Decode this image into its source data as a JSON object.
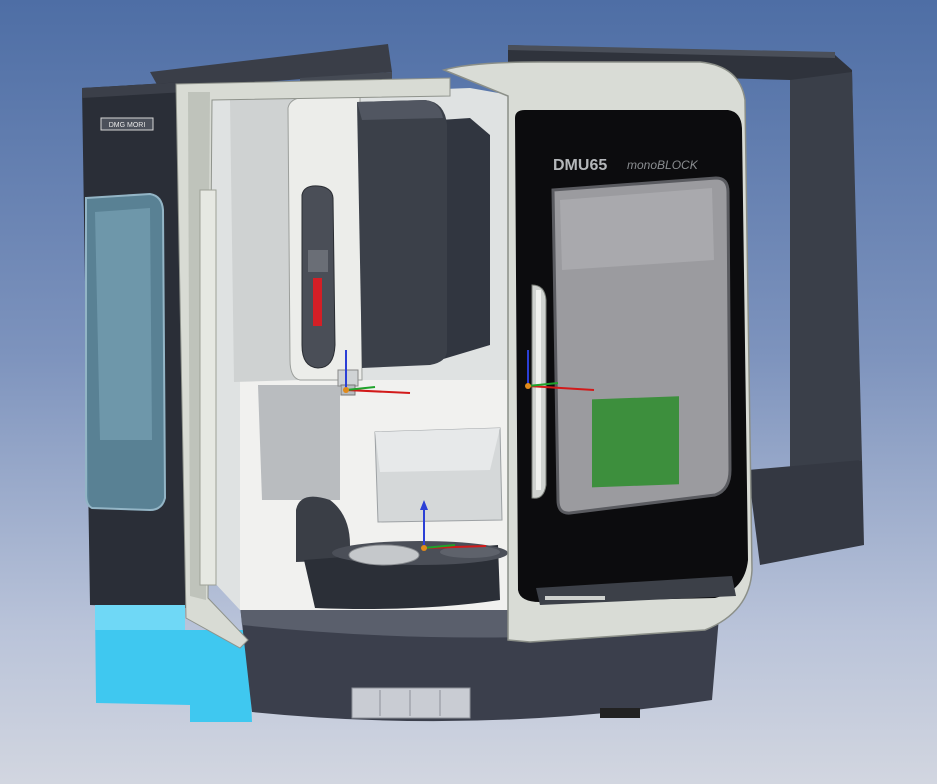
{
  "viewport": {
    "background_top": "#4e6ea5",
    "background_bottom": "#d2d6e0"
  },
  "machine": {
    "model_label": "DMU65",
    "series_label": "monoBLOCK",
    "nameplate_label": "DMG MORI"
  },
  "colors": {
    "cabinet_dark": "#2b2f38",
    "cabinet_side": "#3a3f4a",
    "door_frame": "#d9dcd6",
    "door_panel_black": "#0c0c0e",
    "window_glass": "#9b9b9f",
    "green_screen": "#3d8f3d",
    "cyan_base": "#3fc8f0",
    "spindle_red": "#d41f26",
    "axis_x": "#d21a1a",
    "axis_y": "#1fa32b",
    "axis_z": "#2b3fd6",
    "side_glass": "#5f8ea0"
  },
  "triads": [
    {
      "name": "spindle-triad"
    },
    {
      "name": "door-triad"
    },
    {
      "name": "table-triad"
    }
  ]
}
